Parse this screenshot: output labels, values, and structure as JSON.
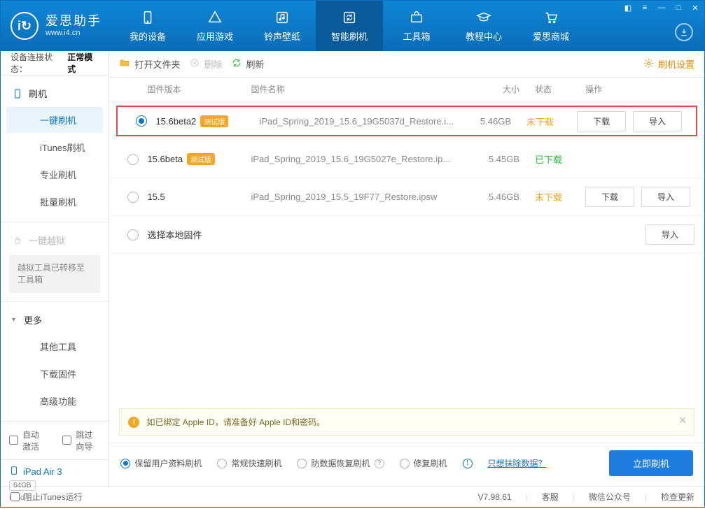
{
  "brand": {
    "name": "爱思助手",
    "url": "www.i4.cn",
    "logo_letter": "i"
  },
  "nav": {
    "items": [
      {
        "id": "device",
        "label": "我的设备"
      },
      {
        "id": "apps",
        "label": "应用游戏"
      },
      {
        "id": "ring",
        "label": "铃声壁纸"
      },
      {
        "id": "flash",
        "label": "智能刷机"
      },
      {
        "id": "tools",
        "label": "工具箱"
      },
      {
        "id": "tutorial",
        "label": "教程中心"
      },
      {
        "id": "store",
        "label": "爱思商城"
      }
    ],
    "active": "flash"
  },
  "sidebar": {
    "status_label": "设备连接状态：",
    "status_value": "正常模式",
    "flash_group": {
      "title": "刷机",
      "items": [
        {
          "id": "oneclick",
          "label": "一键刷机",
          "active": true
        },
        {
          "id": "itunes",
          "label": "iTunes刷机"
        },
        {
          "id": "pro",
          "label": "专业刷机"
        },
        {
          "id": "batch",
          "label": "批量刷机"
        }
      ]
    },
    "jailbreak": {
      "title": "一键越狱",
      "note": "越狱工具已转移至工具箱"
    },
    "more": {
      "title": "更多",
      "items": [
        {
          "id": "othertools",
          "label": "其他工具"
        },
        {
          "id": "dlfw",
          "label": "下载固件"
        },
        {
          "id": "adv",
          "label": "高级功能"
        }
      ]
    },
    "auto_activate": "自动激活",
    "skip_guide": "跳过向导",
    "device": {
      "name": "iPad Air 3",
      "capacity": "64GB",
      "type": "iPad"
    }
  },
  "toolbar": {
    "open_folder": "打开文件夹",
    "delete": "删除",
    "refresh": "刷新",
    "settings": "刷机设置"
  },
  "columns": {
    "version": "固件版本",
    "name": "固件名称",
    "size": "大小",
    "status": "状态",
    "ops": "操作"
  },
  "rows": [
    {
      "version": "15.6beta2",
      "beta": true,
      "name": "iPad_Spring_2019_15.6_19G5037d_Restore.i...",
      "size": "5.46GB",
      "status": "未下载",
      "status_cls": "st-undl",
      "selected": true,
      "highlight": true,
      "show_ops": true
    },
    {
      "version": "15.6beta",
      "beta": true,
      "name": "iPad_Spring_2019_15.6_19G5027e_Restore.ip...",
      "size": "5.45GB",
      "status": "已下载",
      "status_cls": "st-dled",
      "show_ops": false
    },
    {
      "version": "15.5",
      "beta": false,
      "name": "iPad_Spring_2019_15.5_19F77_Restore.ipsw",
      "size": "5.46GB",
      "status": "未下载",
      "status_cls": "st-undl",
      "show_ops": true
    },
    {
      "version": "",
      "beta": false,
      "name_local": "选择本地固件",
      "import_only": true
    }
  ],
  "buttons": {
    "download": "下载",
    "import": "导入"
  },
  "notice": "如已绑定 Apple ID，请准备好 Apple ID和密码。",
  "options": {
    "keep_data": "保留用户资料刷机",
    "normal": "常规快速刷机",
    "antidata": "防数据恢复刷机",
    "repair": "修复刷机",
    "erase_link": "只想抹除数据？",
    "flash_now": "立即刷机"
  },
  "footer": {
    "block_itunes": "阻止iTunes运行",
    "version": "V7.98.61",
    "service": "客服",
    "wechat": "微信公众号",
    "update": "检查更新"
  }
}
